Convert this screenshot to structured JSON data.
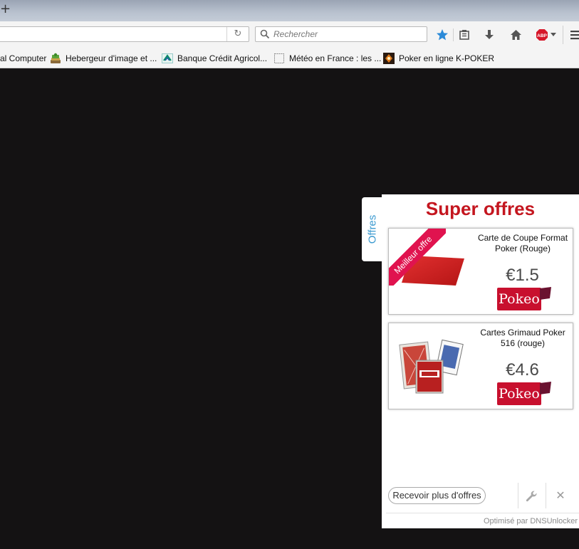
{
  "browser": {
    "new_tab_glyph": "+",
    "url": "",
    "search_placeholder": "Rechercher",
    "toolbar_icons": [
      "reload-icon",
      "search-icon",
      "bookmark-star-icon",
      "reading-list-icon",
      "download-icon",
      "home-icon",
      "adblock-plus-icon",
      "menu-icon"
    ],
    "bookmarks": [
      {
        "label": "al Computer",
        "icon": "computer-icon"
      },
      {
        "label": "Hebergeur d'image et ...",
        "icon": "image-host-icon"
      },
      {
        "label": "Banque Crédit Agricol...",
        "icon": "credit-agricole-icon"
      },
      {
        "label": "Météo en France : les ...",
        "icon": "blank-page-icon"
      },
      {
        "label": "Poker en ligne K-POKER",
        "icon": "kpoker-icon"
      }
    ],
    "adblock_label": "ABP"
  },
  "widget": {
    "tab_label": "Offres",
    "title": "Super offres",
    "offers": [
      {
        "badge": "Meilleur offre",
        "name": "Carte de Coupe Format Poker (Rouge)",
        "price": "€1.5",
        "seller": "Pokeo",
        "image": "red-cut-card"
      },
      {
        "badge": "",
        "name": "Cartes Grimaud Poker 516 (rouge)",
        "price": "€4.6",
        "seller": "Pokeo",
        "image": "grimaud-card-deck"
      }
    ],
    "more_button": "Recevoir plus d'offres",
    "footer": "Optimisé par DNSUnlocker",
    "colors": {
      "title": "#c4161f",
      "tab_text": "#3b9ad0",
      "ribbon": "#e0134f",
      "logo_bg": "#c8102e"
    }
  }
}
